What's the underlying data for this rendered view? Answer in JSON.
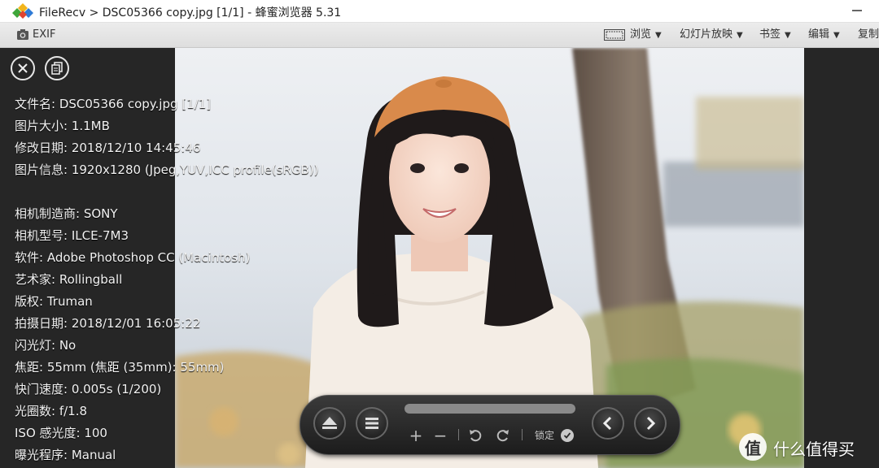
{
  "window": {
    "title": "FileRecv > DSC05366 copy.jpg [1/1] - 蜂蜜浏览器 5.31"
  },
  "toolbar": {
    "exif_label": "EXIF",
    "view_label": "浏览",
    "slideshow_label": "幻灯片放映",
    "bookmark_label": "书签",
    "edit_label": "编辑",
    "copy_label": "复制"
  },
  "info_panel": {
    "lines": [
      "文件名: DSC05366 copy.jpg [1/1]",
      "图片大小: 1.1MB",
      "修改日期: 2018/12/10 14:45:46",
      "图片信息: 1920x1280 (Jpeg,YUV,ICC profile(sRGB))",
      "",
      "相机制造商: SONY",
      "相机型号: ILCE-7M3",
      "软件: Adobe Photoshop CC (Macintosh)",
      "艺术家: Rollingball",
      "版权: Truman",
      "拍摄日期: 2018/12/01 16:05:22",
      "闪光灯: No",
      "焦距: 55mm (焦距 (35mm): 55mm)",
      "快门速度: 0.005s (1/200)",
      "光圈数: f/1.8",
      "ISO 感光度: 100",
      "曝光程序: Manual"
    ]
  },
  "controls": {
    "lock_label": "锁定",
    "zoom_in": "+",
    "zoom_out": "−"
  },
  "watermark": {
    "logo_glyph": "值",
    "text": "什么值得买"
  },
  "colors": {
    "panel_bg": "#262626",
    "toolbar_bg": "#e4e4e4",
    "hat": "#d9894a",
    "sweater": "#f3ece4"
  }
}
